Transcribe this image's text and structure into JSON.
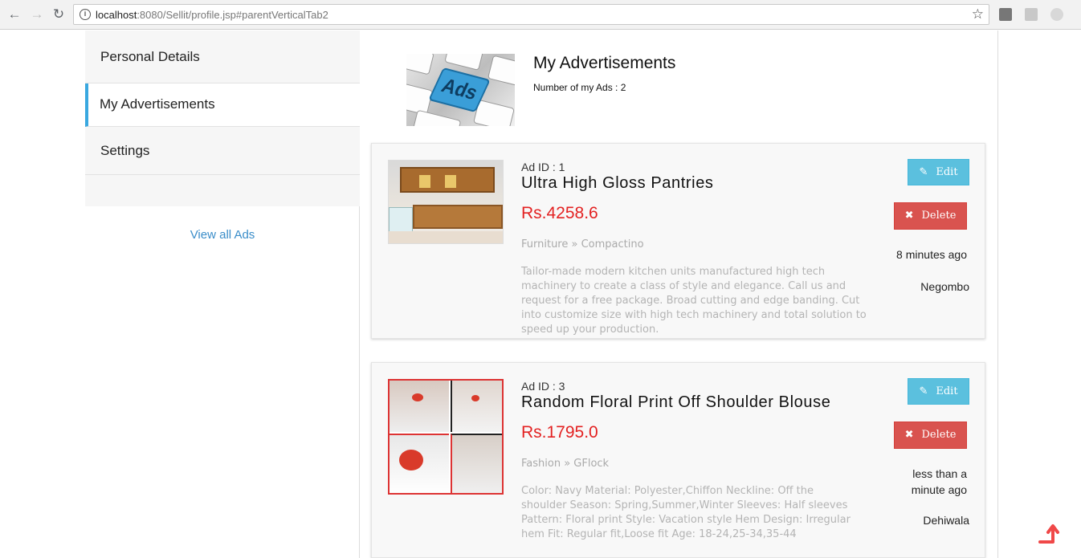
{
  "browser": {
    "url_host": "localhost",
    "url_rest": ":8080/Sellit/profile.jsp#parentVerticalTab2"
  },
  "sidebar": {
    "items": [
      {
        "label": "Personal Details"
      },
      {
        "label": "My Advertisements"
      },
      {
        "label": "Settings"
      }
    ],
    "active_index": 1,
    "view_all_label": "View all Ads",
    "accent": "#3aa8e0"
  },
  "header": {
    "image_label": "Ads",
    "title": "My Advertisements",
    "count_text": "Number of my Ads : 2"
  },
  "ads": [
    {
      "id_text": "Ad ID : 1",
      "title": "Ultra High Gloss Pantries",
      "price": "Rs.4258.6",
      "category": "Furniture » Compactino",
      "description": "Tailor-made modern kitchen units manufactured high tech machinery to create a class of style and elegance. Call us and request for a free package. Broad cutting and edge banding. Cut into customize size with high tech machinery and total solution to speed up your production.",
      "edit_label": "Edit",
      "delete_label": "Delete",
      "time": "8 minutes ago",
      "location": "Negombo"
    },
    {
      "id_text": "Ad ID : 3",
      "title": "Random Floral Print Off Shoulder Blouse",
      "price": "Rs.1795.0",
      "category": "Fashion » GFlock",
      "description": "Color: Navy Material: Polyester,Chiffon Neckline: Off the shoulder Season: Spring,Summer,Winter Sleeves: Half sleeves Pattern: Floral print Style: Vacation style Hem Design: Irregular hem Fit: Regular fit,Loose fit Age: 18-24,25-34,35-44",
      "edit_label": "Edit",
      "delete_label": "Delete",
      "time": "less than a minute ago",
      "location": "Dehiwala"
    }
  ],
  "colors": {
    "price": "#e32222",
    "edit_button": "#5bc0de",
    "delete_button": "#d9534f",
    "scroll_top": "#f04848"
  },
  "icons": {
    "back": "back-arrow-icon",
    "forward": "forward-arrow-icon",
    "reload": "reload-icon",
    "info": "info-icon",
    "bookmark": "star-icon",
    "edit": "edit-icon",
    "delete": "close-x-icon",
    "scroll_top": "scroll-top-arrow-icon"
  }
}
